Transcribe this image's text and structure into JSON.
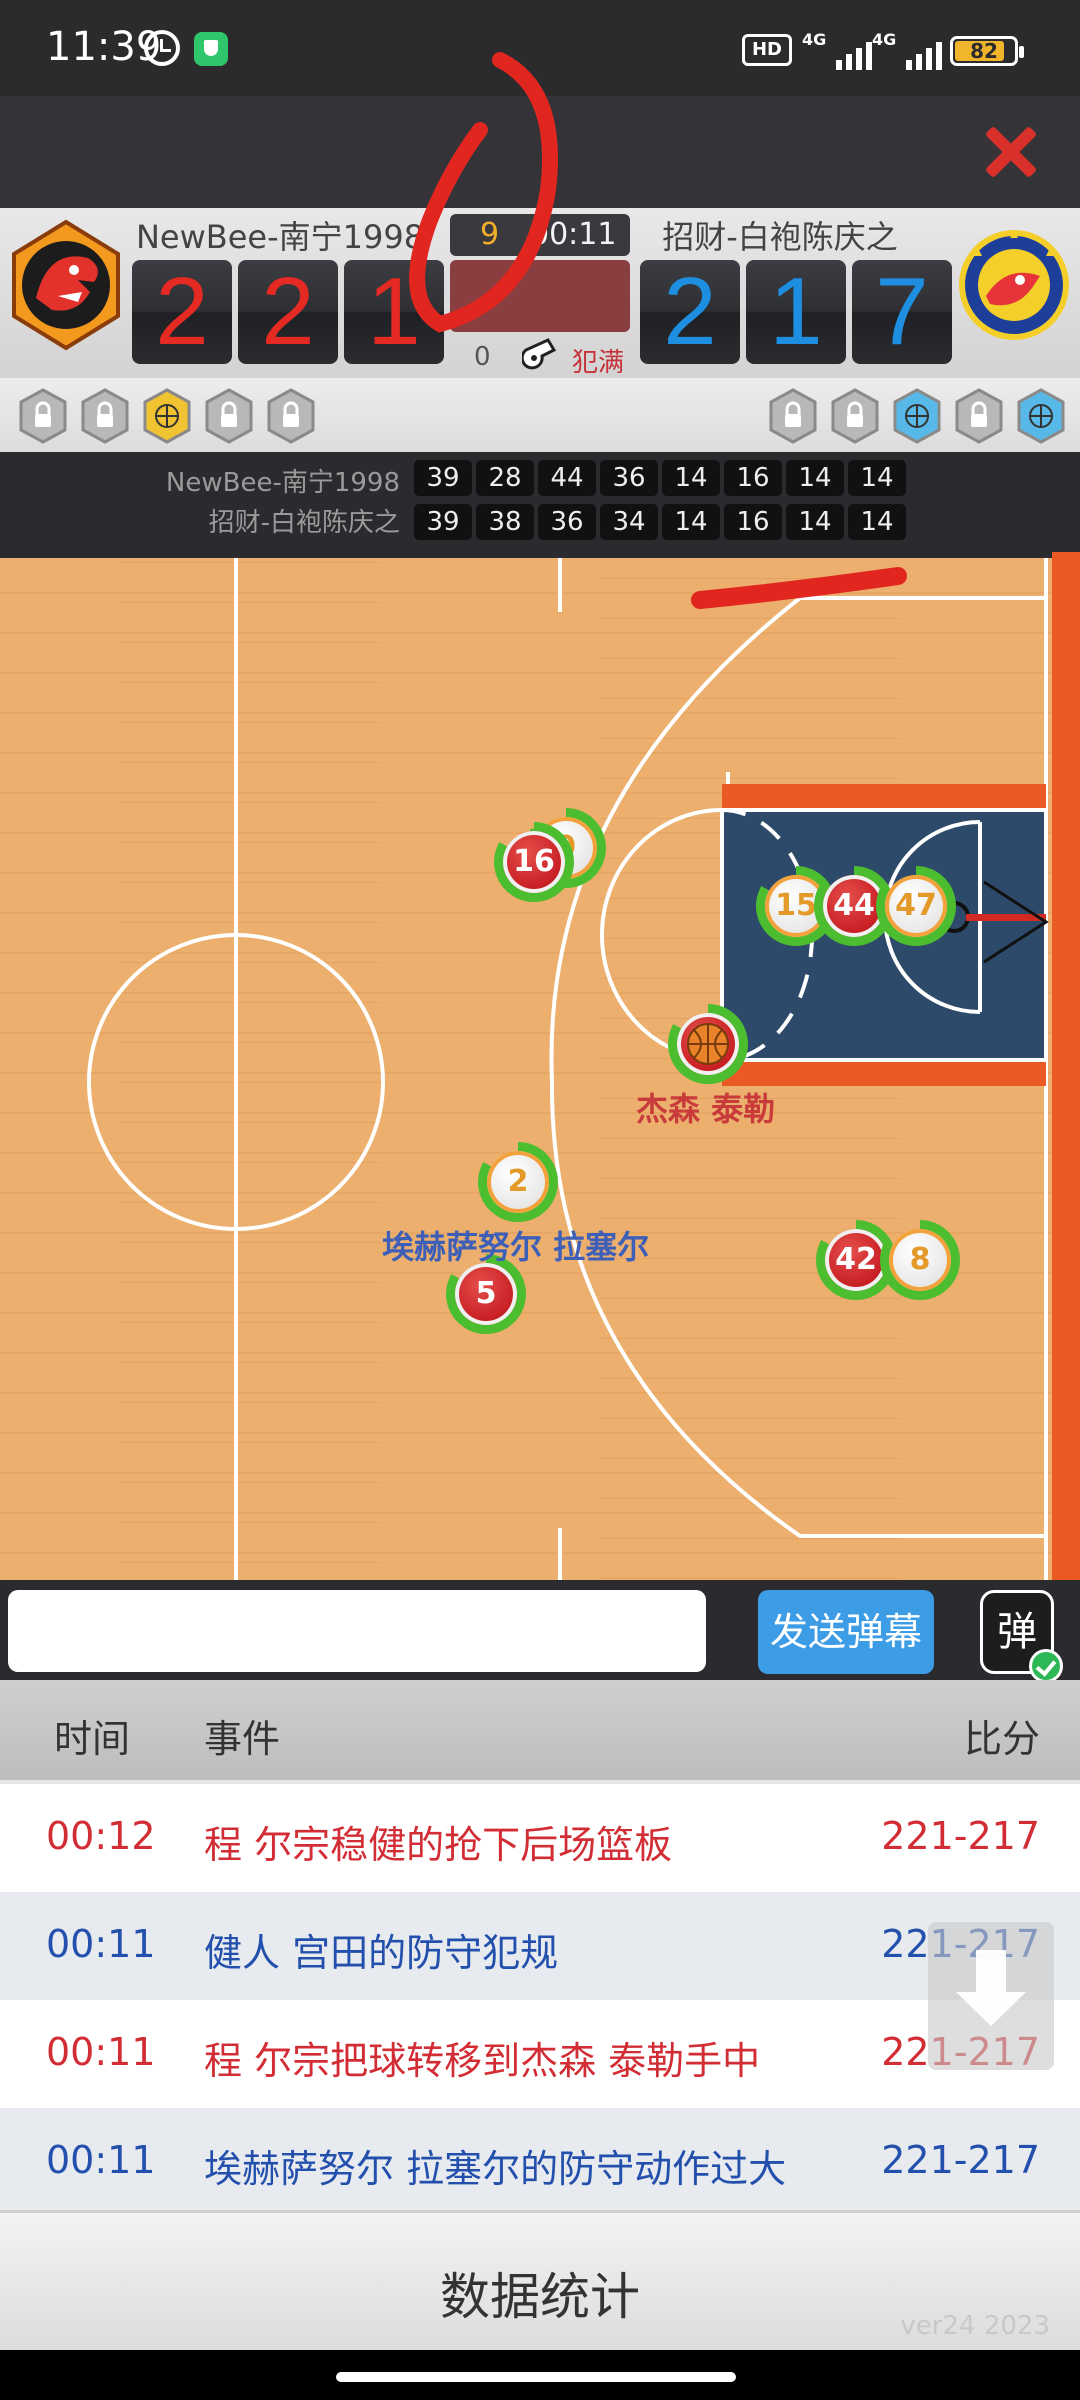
{
  "status_bar": {
    "time": "11:39",
    "hd": "HD",
    "network1": "4G",
    "network2": "4G",
    "battery": "82",
    "battery_level": 0.82,
    "icons": [
      "alarm-icon",
      "shield-app-icon",
      "signal-icon",
      "battery-icon"
    ]
  },
  "scoreboard": {
    "home": {
      "name": "NewBee-南宁1998",
      "score_digits": [
        "2",
        "2",
        "1"
      ],
      "color": "#e52a24"
    },
    "away": {
      "name": "招财-白袍陈庆之",
      "score_digits": [
        "2",
        "1",
        "7"
      ],
      "color": "#1e8fe0"
    },
    "quarter": "9",
    "clock": "00:11",
    "team_fouls": "0",
    "fouls_label": "犯满"
  },
  "quarters": {
    "home": {
      "name": "NewBee-南宁1998",
      "scores": [
        "39",
        "28",
        "44",
        "36",
        "14",
        "16",
        "14",
        "14"
      ]
    },
    "away": {
      "name": "招财-白袍陈庆之",
      "scores": [
        "39",
        "38",
        "36",
        "34",
        "14",
        "16",
        "14",
        "14"
      ]
    }
  },
  "court": {
    "players": [
      {
        "number": "9",
        "team": "away"
      },
      {
        "number": "16",
        "team": "home"
      },
      {
        "number": "15",
        "team": "away"
      },
      {
        "number": "44",
        "team": "home"
      },
      {
        "number": "47",
        "team": "away"
      },
      {
        "number": "",
        "team": "home",
        "has_ball": true
      },
      {
        "number": "2",
        "team": "away"
      },
      {
        "number": "5",
        "team": "home"
      },
      {
        "number": "42",
        "team": "home"
      },
      {
        "number": "8",
        "team": "away"
      }
    ],
    "labels": {
      "ball_handler": "杰森 泰勒",
      "defender": "埃赫萨努尔 拉塞尔"
    }
  },
  "chat": {
    "input_value": "",
    "send_label": "发送弹幕",
    "danmu_label": "弹"
  },
  "events": {
    "headers": {
      "time": "时间",
      "event": "事件",
      "score": "比分"
    },
    "rows": [
      {
        "time": "00:12",
        "text": "程 尔宗稳健的抢下后场篮板",
        "score": "221-217"
      },
      {
        "time": "00:11",
        "text": "健人 宫田的防守犯规",
        "score": "221-217"
      },
      {
        "time": "00:11",
        "text": "程 尔宗把球转移到杰森 泰勒手中",
        "score": "221-217"
      },
      {
        "time": "00:11",
        "text": "埃赫萨努尔 拉塞尔的防守动作过大",
        "score": "221-217"
      }
    ]
  },
  "stats_button": "数据统计",
  "watermark": "ver24 2023"
}
